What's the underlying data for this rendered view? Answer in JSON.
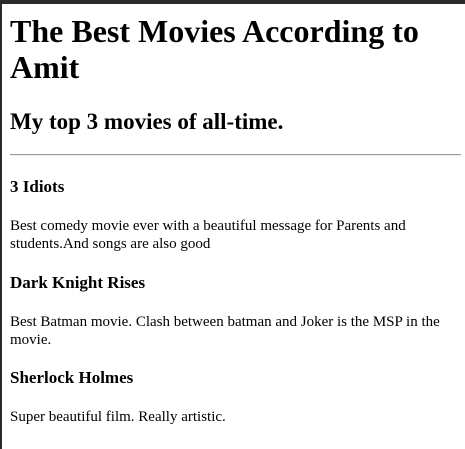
{
  "page": {
    "title": "The Best Movies According to Amit",
    "subtitle": "My top 3 movies of all-time."
  },
  "movies": [
    {
      "title": "3 Idiots",
      "description": "Best comedy movie ever with a beautiful message for Parents and students.And songs are also good"
    },
    {
      "title": "Dark Knight Rises",
      "description": "Best Batman movie. Clash between batman and Joker is the MSP in the movie."
    },
    {
      "title": "Sherlock Holmes",
      "description": "Super beautiful film. Really artistic."
    }
  ]
}
